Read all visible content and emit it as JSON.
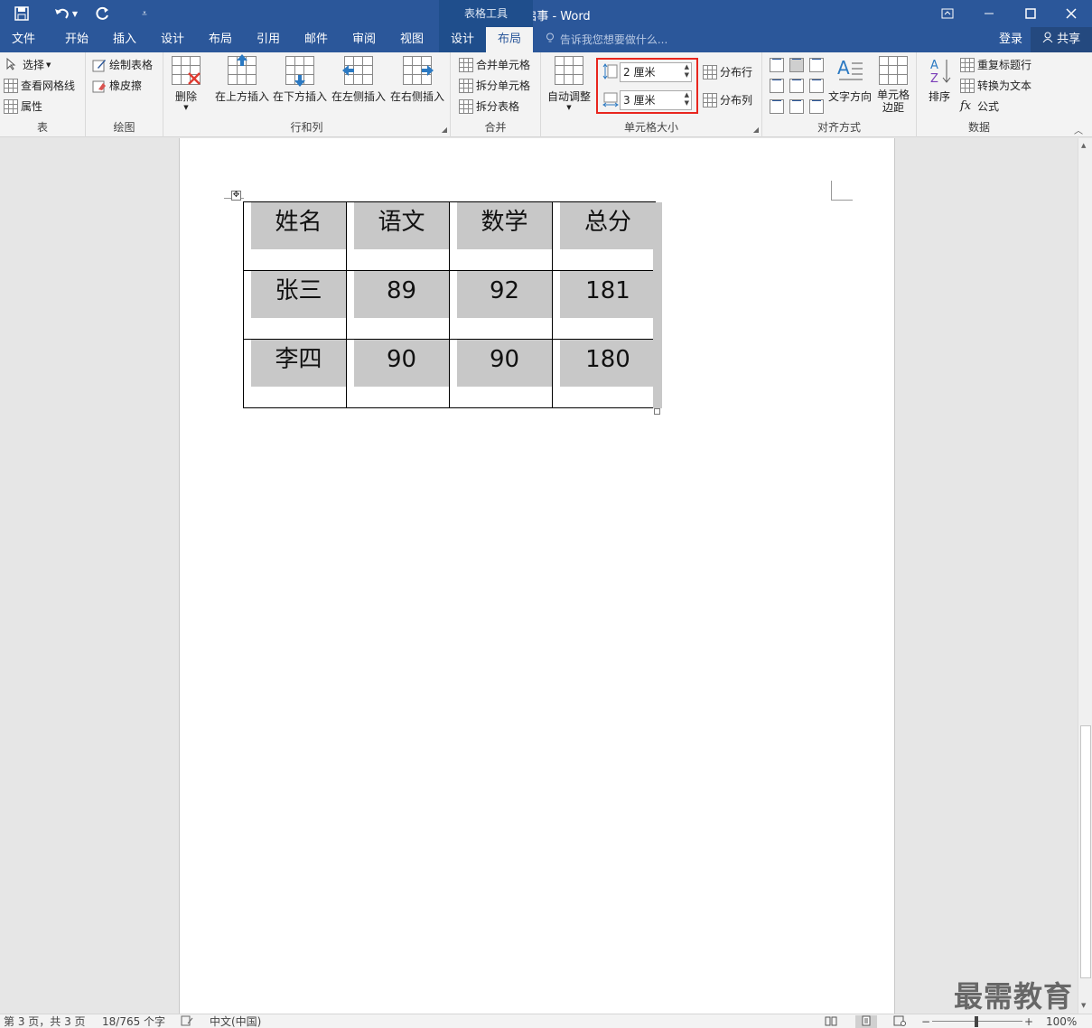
{
  "titlebar": {
    "title": "招聘启事 - Word",
    "context_label": "表格工具",
    "icons": [
      "save-icon",
      "undo-icon",
      "redo-icon",
      "customize-qat-icon",
      "ribbon-display-icon",
      "minimize-icon",
      "maximize-icon",
      "close-icon"
    ]
  },
  "tabs": [
    "文件",
    "开始",
    "插入",
    "设计",
    "布局",
    "引用",
    "邮件",
    "审阅",
    "视图",
    "设计",
    "布局"
  ],
  "active_tab": "布局",
  "tell_me": "告诉我您想要做什么...",
  "login": "登录",
  "share": "共享",
  "ribbon": {
    "table": {
      "label": "表",
      "select": "选择",
      "view_gridlines": "查看网格线",
      "properties": "属性"
    },
    "draw": {
      "label": "绘图",
      "draw_table": "绘制表格",
      "eraser": "橡皮擦"
    },
    "rows_cols": {
      "label": "行和列",
      "delete": "删除",
      "insert_above": "在上方插入",
      "insert_below": "在下方插入",
      "insert_left": "在左侧插入",
      "insert_right": "在右侧插入"
    },
    "merge": {
      "label": "合并",
      "merge_cells": "合并单元格",
      "split_cells": "拆分单元格",
      "split_table": "拆分表格"
    },
    "cell_size": {
      "label": "单元格大小",
      "autofit": "自动调整",
      "height_value": "2 厘米",
      "width_value": "3 厘米",
      "distribute_rows": "分布行",
      "distribute_cols": "分布列",
      "highlight_color": "#e8261e"
    },
    "alignment": {
      "label": "对齐方式",
      "text_direction": "文字方向",
      "cell_margins": "单元格边距"
    },
    "data": {
      "label": "数据",
      "sort": "排序",
      "repeat_header": "重复标题行",
      "convert_to_text": "转换为文本",
      "formula": "公式"
    }
  },
  "table": {
    "rows": [
      [
        "姓名",
        "语文",
        "数学",
        "总分"
      ],
      [
        "张三",
        "89",
        "92",
        "181"
      ],
      [
        "李四",
        "90",
        "90",
        "180"
      ]
    ]
  },
  "status": {
    "page": "第 3 页，共 3 页",
    "words": "18/765 个字",
    "language": "中文(中国)",
    "zoom": "100%"
  },
  "watermark": "最需教育",
  "colors": {
    "accent": "#2b579a",
    "shading": "#c8c8c8"
  }
}
